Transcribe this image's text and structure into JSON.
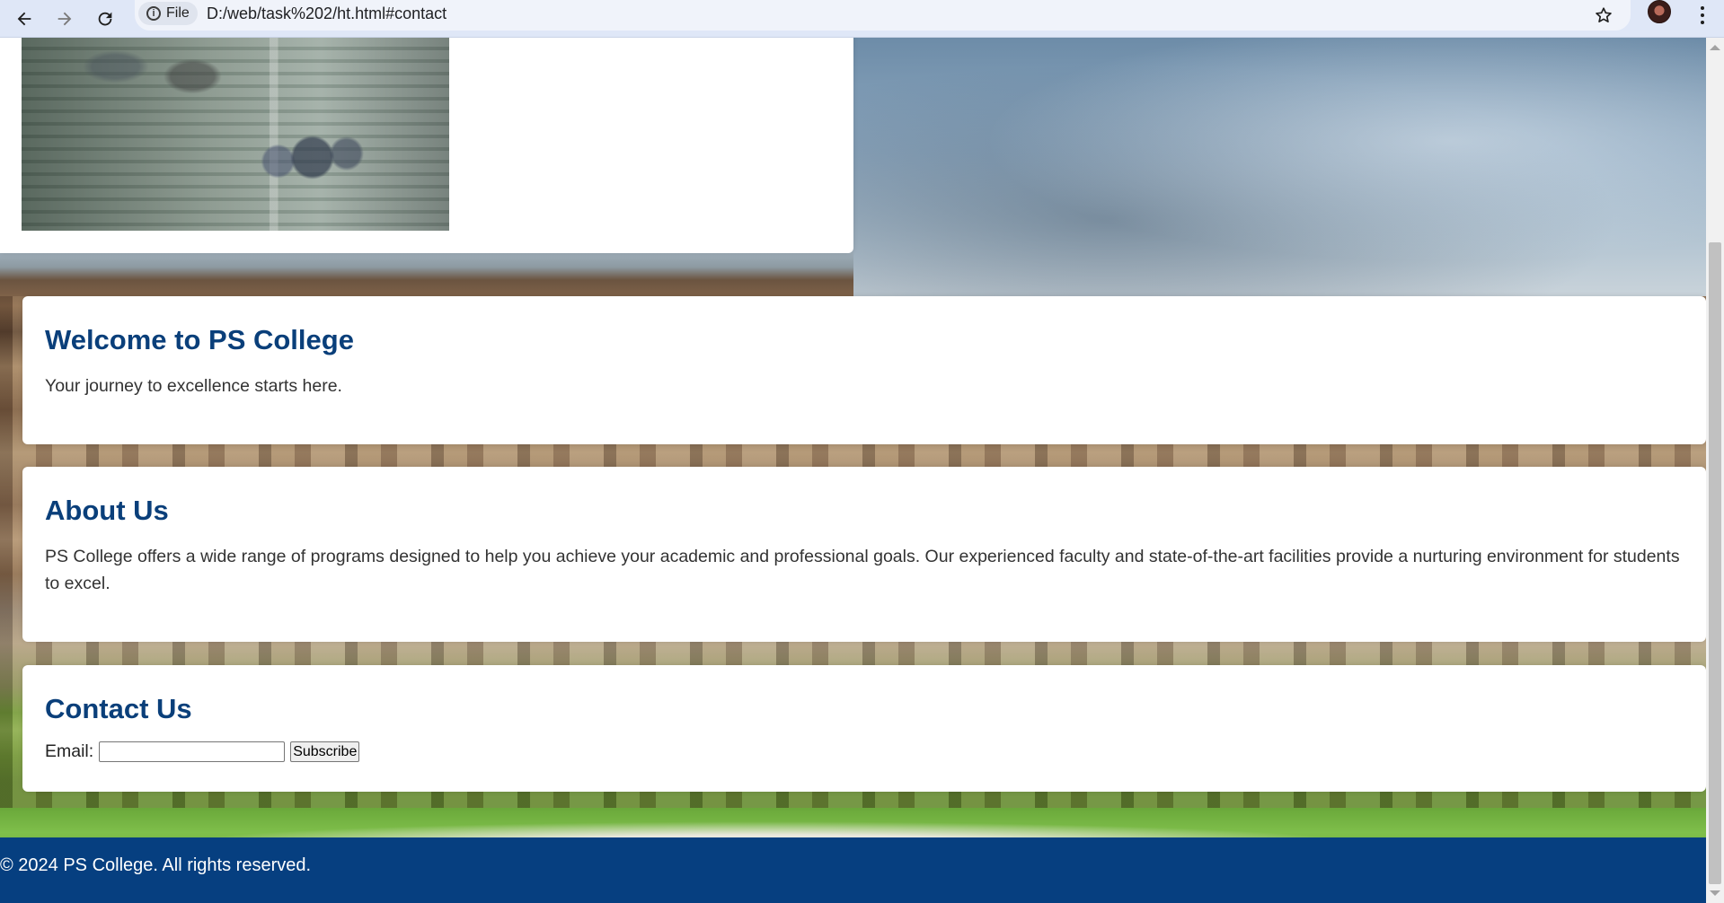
{
  "browser": {
    "site_chip_label": "File",
    "url": "D:/web/task%202/ht.html#contact"
  },
  "icons": {
    "back": "arrow-left",
    "forward": "arrow-right",
    "reload": "reload",
    "info": "info-circle",
    "bookmark": "star-outline",
    "menu": "three-dots-vertical"
  },
  "sections": {
    "welcome": {
      "title": "Welcome to PS College",
      "text": "Your journey to excellence starts here."
    },
    "about": {
      "title": "About Us",
      "text": "PS College offers a wide range of programs designed to help you achieve your academic and professional goals. Our experienced faculty and state-of-the-art facilities provide a nurturing environment for students to excel."
    },
    "contact": {
      "title": "Contact Us",
      "email_label": "Email:",
      "email_value": "",
      "subscribe_label": "Subscribe"
    }
  },
  "footer": {
    "text": "© 2024 PS College. All rights reserved."
  },
  "colors": {
    "heading": "#0a3f7a",
    "footer_bg": "#063f80",
    "browser_toolbar": "#dfe7f7"
  }
}
